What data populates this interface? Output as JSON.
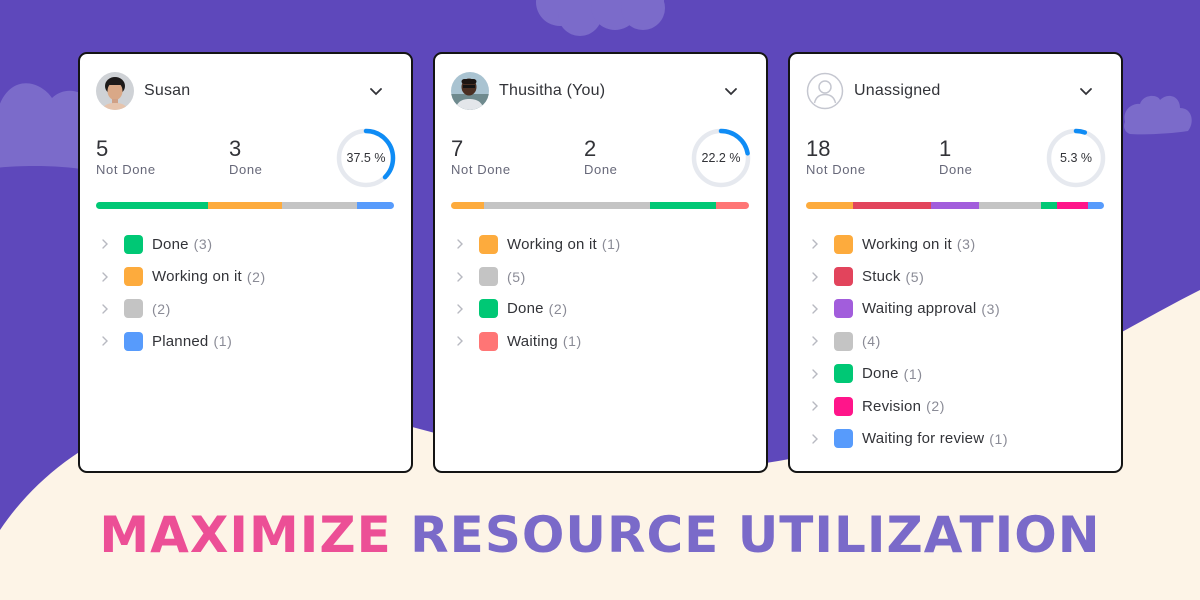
{
  "colors": {
    "background_purple": "#5e48bb",
    "background_cream": "#fdf4e7",
    "cloud": "#7b6bca",
    "progress_accent": "#0f8cf5",
    "progress_track": "#e6e9ef",
    "headline_pink": "#ec4f96",
    "headline_purple": "#7a6ac9"
  },
  "status_colors": {
    "Done": "#00c875",
    "Working on it": "#fdab3d",
    "Blank": "#c4c4c4",
    "Planned": "#579bfc",
    "Waiting": "#ff7575",
    "Stuck": "#e2445c",
    "Waiting approval": "#a25ddc",
    "Revision": "#ff158a",
    "Waiting for review": "#579bfc"
  },
  "cards": [
    {
      "user": "Susan",
      "avatar": "photo-woman",
      "not_done": "5",
      "not_done_label": "Not Done",
      "done": "3",
      "done_label": "Done",
      "percent_text": "37.5 %",
      "percent_value": 37.5,
      "statuses": [
        {
          "label": "Done",
          "count_text": "(3)",
          "count": 3,
          "color": "#00c875"
        },
        {
          "label": "Working on it",
          "count_text": "(2)",
          "count": 2,
          "color": "#fdab3d"
        },
        {
          "label": "",
          "count_text": "(2)",
          "count": 2,
          "color": "#c4c4c4"
        },
        {
          "label": "Planned",
          "count_text": "(1)",
          "count": 1,
          "color": "#579bfc"
        }
      ]
    },
    {
      "user": "Thusitha (You)",
      "avatar": "photo-man",
      "not_done": "7",
      "not_done_label": "Not Done",
      "done": "2",
      "done_label": "Done",
      "percent_text": "22.2 %",
      "percent_value": 22.2,
      "statuses": [
        {
          "label": "Working on it",
          "count_text": "(1)",
          "count": 1,
          "color": "#fdab3d"
        },
        {
          "label": "",
          "count_text": "(5)",
          "count": 5,
          "color": "#c4c4c4"
        },
        {
          "label": "Done",
          "count_text": "(2)",
          "count": 2,
          "color": "#00c875"
        },
        {
          "label": "Waiting",
          "count_text": "(1)",
          "count": 1,
          "color": "#ff7575"
        }
      ]
    },
    {
      "user": "Unassigned",
      "avatar": "placeholder-user",
      "not_done": "18",
      "not_done_label": "Not Done",
      "done": "1",
      "done_label": "Done",
      "percent_text": "5.3 %",
      "percent_value": 5.3,
      "statuses": [
        {
          "label": "Working on it",
          "count_text": "(3)",
          "count": 3,
          "color": "#fdab3d"
        },
        {
          "label": "Stuck",
          "count_text": "(5)",
          "count": 5,
          "color": "#e2445c"
        },
        {
          "label": "Waiting approval",
          "count_text": "(3)",
          "count": 3,
          "color": "#a25ddc"
        },
        {
          "label": "",
          "count_text": "(4)",
          "count": 4,
          "color": "#c4c4c4"
        },
        {
          "label": "Done",
          "count_text": "(1)",
          "count": 1,
          "color": "#00c875"
        },
        {
          "label": "Revision",
          "count_text": "(2)",
          "count": 2,
          "color": "#ff158a"
        },
        {
          "label": "Waiting for review",
          "count_text": "(1)",
          "count": 1,
          "color": "#579bfc"
        }
      ]
    }
  ],
  "headline": {
    "word1": "MAXIMIZE",
    "word2": "RESOURCE UTILIZATION"
  }
}
